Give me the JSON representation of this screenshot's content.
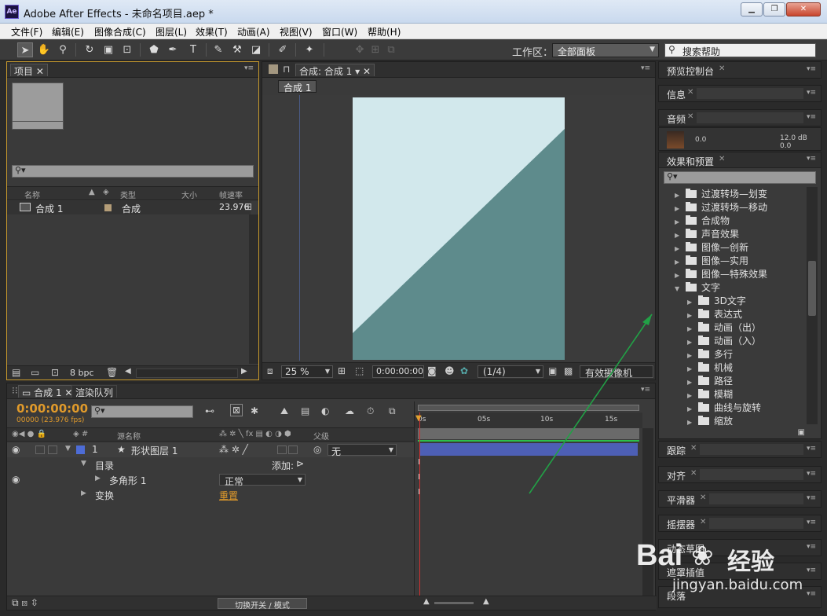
{
  "window": {
    "title": "Adobe After Effects - 未命名项目.aep *",
    "app_icon": "Ae",
    "controls": [
      "▁",
      "❐",
      "✕"
    ]
  },
  "menu": [
    "文件(F)",
    "编辑(E)",
    "图像合成(C)",
    "图层(L)",
    "效果(T)",
    "动画(A)",
    "视图(V)",
    "窗口(W)",
    "帮助(H)"
  ],
  "toolbar": {
    "workspace_label": "工作区：",
    "workspace_value": "全部面板",
    "search_placeholder": "搜索帮助"
  },
  "project": {
    "tab": "项目",
    "columns": [
      "名称",
      "类型",
      "大小",
      "帧速率"
    ],
    "items": [
      {
        "name": "合成 1",
        "type": "合成",
        "fps": "23.976"
      }
    ],
    "bpc": "8 bpc"
  },
  "composition": {
    "tab": "合成: 合成 1",
    "breadcrumb": "合成 1",
    "zoom": "25 %",
    "timecode": "0:00:00:00",
    "resolution": "(1/4)",
    "camera": "有效摄像机",
    "colors": {
      "bg": "#d2e8ec",
      "shape": "#5e8b8c"
    }
  },
  "right_panels": {
    "preview": "预览控制台",
    "info": "信息",
    "audio": "音频",
    "audio_values": {
      "left": "0.0",
      "right": "12.0 dB",
      "right2": "0.0"
    },
    "effects": "效果和预置",
    "tracker": "跟踪",
    "align": "对齐",
    "smoother": "平滑器",
    "wiggler": "摇摆器",
    "motion_sketch": "动态草图",
    "mask": "遮罩插值",
    "brush": "段落"
  },
  "effects_tree": [
    {
      "label": "过渡转场—划变",
      "level": 0,
      "open": false
    },
    {
      "label": "过渡转场—移动",
      "level": 0,
      "open": false
    },
    {
      "label": "合成物",
      "level": 0,
      "open": false
    },
    {
      "label": "声音效果",
      "level": 0,
      "open": false
    },
    {
      "label": "图像—创新",
      "level": 0,
      "open": false
    },
    {
      "label": "图像—实用",
      "level": 0,
      "open": false
    },
    {
      "label": "图像—特殊效果",
      "level": 0,
      "open": false
    },
    {
      "label": "文字",
      "level": 0,
      "open": true
    },
    {
      "label": "3D文字",
      "level": 1,
      "open": false
    },
    {
      "label": "表达式",
      "level": 1,
      "open": false
    },
    {
      "label": "动画（出）",
      "level": 1,
      "open": false
    },
    {
      "label": "动画（入）",
      "level": 1,
      "open": false
    },
    {
      "label": "多行",
      "level": 1,
      "open": false
    },
    {
      "label": "机械",
      "level": 1,
      "open": false
    },
    {
      "label": "路径",
      "level": 1,
      "open": false
    },
    {
      "label": "模糊",
      "level": 1,
      "open": false
    },
    {
      "label": "曲线与旋转",
      "level": 1,
      "open": false
    },
    {
      "label": "缩放",
      "level": 1,
      "open": false
    }
  ],
  "timeline": {
    "tabs": [
      "合成 1",
      "渲染队列"
    ],
    "timecode": "0:00:00:00",
    "frame_info": "00000 (23.976 fps)",
    "col_source": "源名称",
    "col_parent": "父级",
    "layer_num": "1",
    "layer_name": "形状图层 1",
    "parent_value": "无",
    "contents": "目录",
    "add_label": "添加:",
    "polygon": "多角形 1",
    "blend_mode": "正常",
    "transform": "变换",
    "reset": "重置",
    "ruler": [
      "0s",
      "05s",
      "10s",
      "15s"
    ],
    "footer": "切换开关 / 模式"
  },
  "watermark": {
    "brand": "Bai",
    "brand2": "经验",
    "url": "jingyan.baidu.com"
  }
}
